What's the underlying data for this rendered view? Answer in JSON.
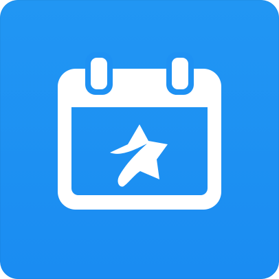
{
  "icon": {
    "name": "calendar-star-app-icon",
    "background_color": "#1e91f3",
    "glyph_color": "#ffffff"
  }
}
